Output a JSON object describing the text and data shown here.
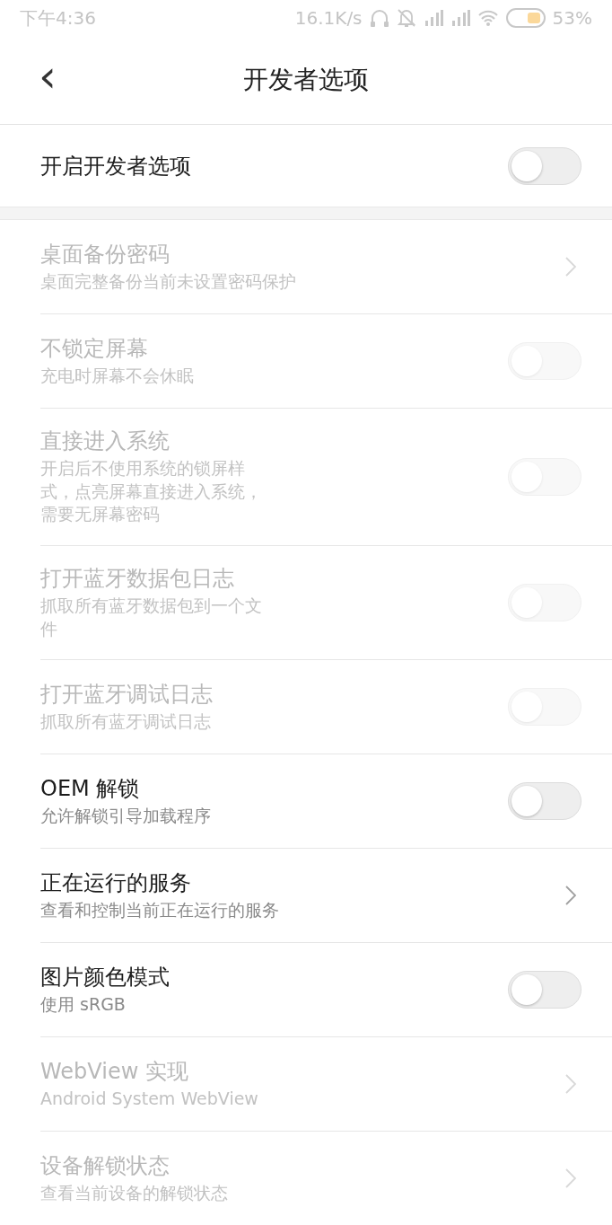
{
  "status_bar": {
    "time": "下午4:36",
    "speed": "16.1K/s",
    "battery": "53%"
  },
  "header": {
    "back": "‹",
    "title": "开发者选项"
  },
  "master": {
    "label": "开启开发者选项",
    "on": false
  },
  "items": [
    {
      "kind": "link",
      "title": "桌面备份密码",
      "subtitle": "桌面完整备份当前未设置密码保护",
      "disabled": true
    },
    {
      "kind": "switch",
      "title": "不锁定屏幕",
      "subtitle": "充电时屏幕不会休眠",
      "disabled": true,
      "on": false
    },
    {
      "kind": "switch",
      "title": "直接进入系统",
      "subtitle": "开启后不使用系统的锁屏样式，点亮屏幕直接进入系统，需要无屏幕密码",
      "disabled": true,
      "on": false
    },
    {
      "kind": "switch",
      "title": "打开蓝牙数据包日志",
      "subtitle": "抓取所有蓝牙数据包到一个文件",
      "disabled": true,
      "on": false
    },
    {
      "kind": "switch",
      "title": "打开蓝牙调试日志",
      "subtitle": "抓取所有蓝牙调试日志",
      "disabled": true,
      "on": false
    },
    {
      "kind": "switch",
      "title": "OEM 解锁",
      "subtitle": "允许解锁引导加载程序",
      "disabled": false,
      "on": false
    },
    {
      "kind": "link",
      "title": "正在运行的服务",
      "subtitle": "查看和控制当前正在运行的服务",
      "disabled": false
    },
    {
      "kind": "switch",
      "title": "图片颜色模式",
      "subtitle": "使用 sRGB",
      "disabled": false,
      "on": false
    },
    {
      "kind": "link",
      "title": "WebView 实现",
      "subtitle": "Android System WebView",
      "disabled": true
    },
    {
      "kind": "link",
      "title": "设备解锁状态",
      "subtitle": "查看当前设备的解锁状态",
      "disabled": true
    }
  ]
}
